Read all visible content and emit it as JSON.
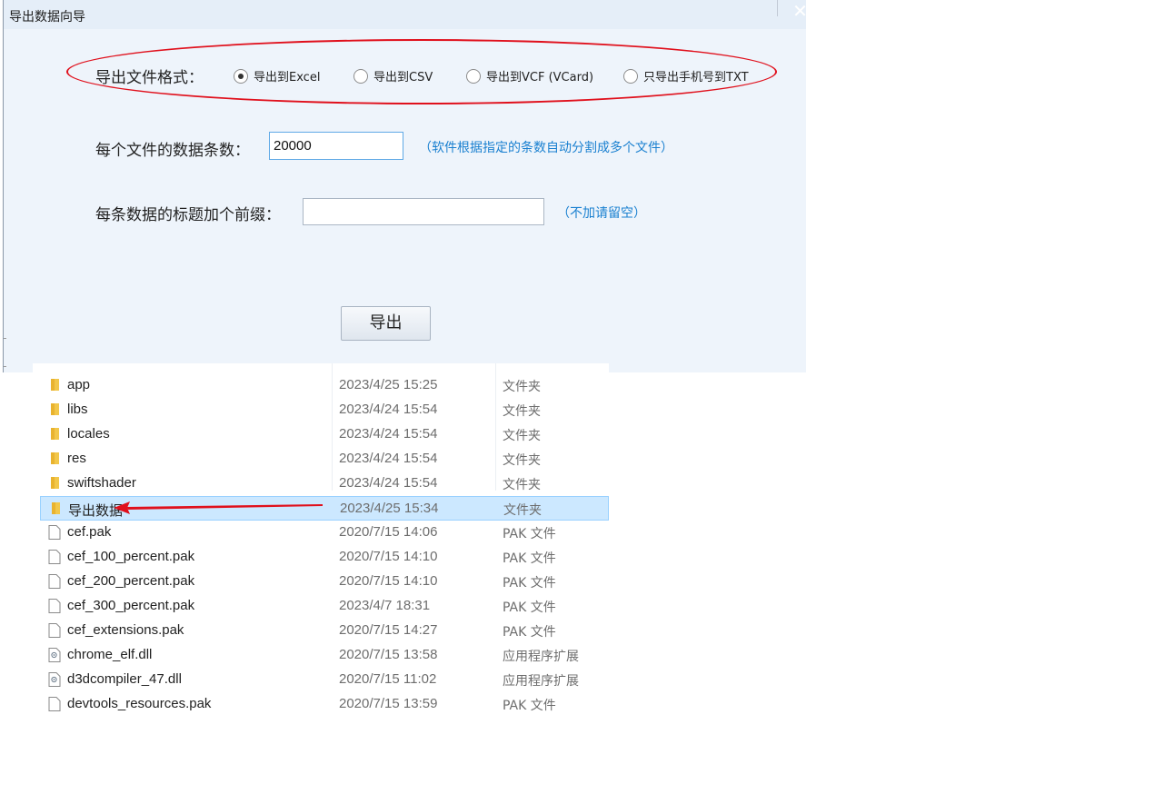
{
  "dialog": {
    "title": "导出数据向导",
    "close_glyph": "✕",
    "format_label": "导出文件格式：",
    "formats": [
      {
        "label": "导出到Excel",
        "selected": true
      },
      {
        "label": "导出到CSV",
        "selected": false
      },
      {
        "label": "导出到VCF (VCard)",
        "selected": false
      },
      {
        "label": "只导出手机号到TXT",
        "selected": false
      }
    ],
    "records_label": "每个文件的数据条数：",
    "records_value": "20000",
    "records_hint": "（软件根据指定的条数自动分割成多个文件）",
    "prefix_label": "每条数据的标题加个前缀：",
    "prefix_value": "",
    "prefix_hint": "（不加请留空）",
    "export_button": "导出"
  },
  "annotation": {
    "ellipse_color": "#e0101c",
    "arrow_color": "#e0101c"
  },
  "files": [
    {
      "name": "app",
      "date": "2023/4/25 15:25",
      "type": "文件夹",
      "icon": "folder-icon",
      "selected": false
    },
    {
      "name": "libs",
      "date": "2023/4/24 15:54",
      "type": "文件夹",
      "icon": "folder-icon",
      "selected": false
    },
    {
      "name": "locales",
      "date": "2023/4/24 15:54",
      "type": "文件夹",
      "icon": "folder-icon",
      "selected": false
    },
    {
      "name": "res",
      "date": "2023/4/24 15:54",
      "type": "文件夹",
      "icon": "folder-icon",
      "selected": false
    },
    {
      "name": "swiftshader",
      "date": "2023/4/24 15:54",
      "type": "文件夹",
      "icon": "folder-icon",
      "selected": false
    },
    {
      "name": "导出数据",
      "date": "2023/4/25 15:34",
      "type": "文件夹",
      "icon": "folder-icon",
      "selected": true
    },
    {
      "name": "cef.pak",
      "date": "2020/7/15 14:06",
      "type": "PAK 文件",
      "icon": "file-icon",
      "selected": false
    },
    {
      "name": "cef_100_percent.pak",
      "date": "2020/7/15 14:10",
      "type": "PAK 文件",
      "icon": "file-icon",
      "selected": false
    },
    {
      "name": "cef_200_percent.pak",
      "date": "2020/7/15 14:10",
      "type": "PAK 文件",
      "icon": "file-icon",
      "selected": false
    },
    {
      "name": "cef_300_percent.pak",
      "date": "2023/4/7 18:31",
      "type": "PAK 文件",
      "icon": "file-icon",
      "selected": false
    },
    {
      "name": "cef_extensions.pak",
      "date": "2020/7/15 14:27",
      "type": "PAK 文件",
      "icon": "file-icon",
      "selected": false
    },
    {
      "name": "chrome_elf.dll",
      "date": "2020/7/15 13:58",
      "type": "应用程序扩展",
      "icon": "dll-file-icon",
      "selected": false
    },
    {
      "name": "d3dcompiler_47.dll",
      "date": "2020/7/15 11:02",
      "type": "应用程序扩展",
      "icon": "dll-file-icon",
      "selected": false
    },
    {
      "name": "devtools_resources.pak",
      "date": "2020/7/15 13:59",
      "type": "PAK 文件",
      "icon": "file-icon",
      "selected": false
    }
  ]
}
